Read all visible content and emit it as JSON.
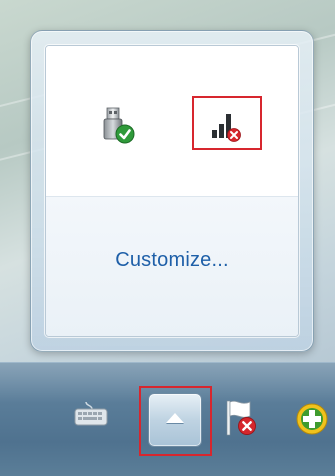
{
  "flyout": {
    "customize_label": "Customize...",
    "icons": [
      {
        "name": "safely-remove-hardware-icon",
        "status": "ok"
      },
      {
        "name": "network-disconnected-icon",
        "status": "error",
        "highlighted": true
      }
    ]
  },
  "taskbar": {
    "items": [
      {
        "name": "keyboard-icon"
      },
      {
        "name": "show-hidden-icons-button",
        "highlighted": true
      },
      {
        "name": "action-center-flag-error-icon"
      },
      {
        "name": "add-icon"
      }
    ]
  },
  "colors": {
    "highlight": "#d7262e",
    "link": "#1e5fa8",
    "ok_green": "#2f9a3a",
    "error_red": "#d6262c"
  }
}
